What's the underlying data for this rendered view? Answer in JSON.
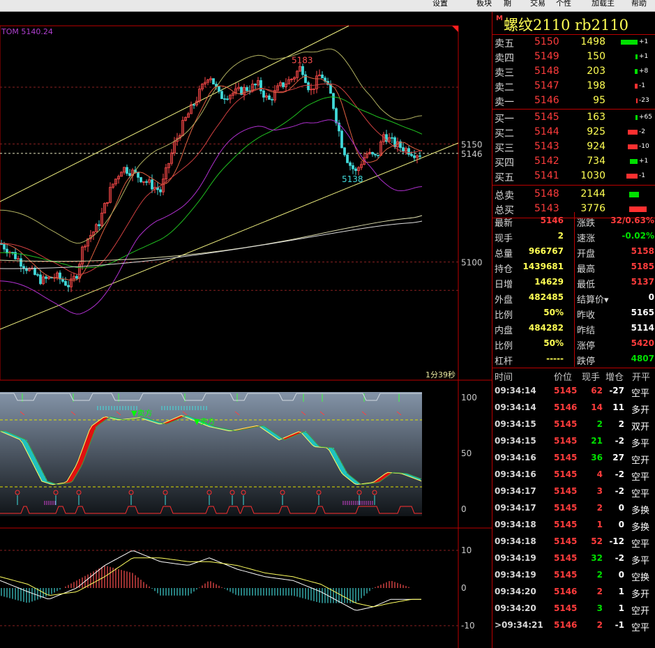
{
  "menu": [
    "设置",
    "板块",
    "期",
    "交易",
    "个性",
    "加载主",
    "帮助"
  ],
  "main_chart": {
    "indicator_label": "TOM 5140.24",
    "price_labels": [
      {
        "text": "5183",
        "price": 5183
      },
      {
        "text": "5138",
        "price": 5138
      }
    ],
    "axis_ticks": [
      {
        "text": "5150",
        "price": 5150
      },
      {
        "text": "5146",
        "price": 5146
      },
      {
        "text": "5100",
        "price": 5100
      }
    ],
    "dashed_levels": [
      5174,
      5150,
      5146,
      5100,
      5088
    ],
    "timer": "1分39秒",
    "price_min": 5050,
    "price_max": 5200
  },
  "kd_panel": {
    "ticks": [
      "100",
      "50",
      "0"
    ],
    "annotations": [
      {
        "text": "▼卖方",
        "color": "#00ff00"
      },
      {
        "text": "▼卖方",
        "color": "#00ff00"
      }
    ]
  },
  "macd_panel": {
    "ticks": [
      "10",
      "0",
      "-10"
    ]
  },
  "instrument": {
    "marker": "M",
    "name": "螺纹2110  rb2110"
  },
  "asks": [
    {
      "label": "卖五",
      "price": "5150",
      "volume": "1498",
      "change": "+1",
      "bar": 24
    },
    {
      "label": "卖四",
      "price": "5149",
      "volume": "150",
      "change": "+1",
      "bar": 3
    },
    {
      "label": "卖三",
      "price": "5148",
      "volume": "203",
      "change": "+8",
      "bar": 4
    },
    {
      "label": "卖二",
      "price": "5147",
      "volume": "198",
      "change": "-1",
      "bar": 4
    },
    {
      "label": "卖一",
      "price": "5146",
      "volume": "95",
      "change": "-23",
      "bar": 2
    }
  ],
  "bids": [
    {
      "label": "买一",
      "price": "5145",
      "volume": "163",
      "change": "+65",
      "bar": 3
    },
    {
      "label": "买二",
      "price": "5144",
      "volume": "925",
      "change": "-2",
      "bar": 14
    },
    {
      "label": "买三",
      "price": "5143",
      "volume": "924",
      "change": "-10",
      "bar": 14
    },
    {
      "label": "买四",
      "price": "5142",
      "volume": "734",
      "change": "+1",
      "bar": 11
    },
    {
      "label": "买五",
      "price": "5141",
      "volume": "1030",
      "change": "-1",
      "bar": 16
    }
  ],
  "totals": [
    {
      "label": "总卖",
      "price": "5148",
      "volume": "2144",
      "bar": 14,
      "bar_color": "#00e000"
    },
    {
      "label": "总买",
      "price": "5143",
      "volume": "3776",
      "bar": 25,
      "bar_color": "#ff3030"
    }
  ],
  "stats": [
    {
      "l1": "最新",
      "v1": "5146",
      "c1": "red",
      "l2": "涨跌",
      "v2": "32/0.63%",
      "c2": "red"
    },
    {
      "l1": "现手",
      "v1": "2",
      "c1": "yellow",
      "l2": "速涨",
      "v2": "-0.02%",
      "c2": "green"
    },
    {
      "l1": "总量",
      "v1": "966767",
      "c1": "yellow",
      "l2": "开盘",
      "v2": "5158",
      "c2": "red"
    },
    {
      "l1": "持仓",
      "v1": "1439681",
      "c1": "yellow",
      "l2": "最高",
      "v2": "5185",
      "c2": "red"
    },
    {
      "l1": "日增",
      "v1": "14629",
      "c1": "yellow",
      "l2": "最低",
      "v2": "5137",
      "c2": "red"
    },
    {
      "l1": "外盘",
      "v1": "482485",
      "c1": "yellow",
      "l2": "结算价▾",
      "v2": "0",
      "c2": "white"
    },
    {
      "l1": "比例",
      "v1": "50%",
      "c1": "yellow",
      "l2": "昨收",
      "v2": "5165",
      "c2": "white"
    },
    {
      "l1": "内盘",
      "v1": "484282",
      "c1": "yellow",
      "l2": "昨结",
      "v2": "5114",
      "c2": "white"
    },
    {
      "l1": "比例",
      "v1": "50%",
      "c1": "yellow",
      "l2": "涨停",
      "v2": "5420",
      "c2": "red"
    },
    {
      "l1": "杠杆",
      "v1": "-----",
      "c1": "yellow",
      "l2": "跌停",
      "v2": "4807",
      "c2": "green"
    }
  ],
  "ticks_header": [
    "时间",
    "价位",
    "现手",
    "增仓",
    "开平"
  ],
  "trades": [
    {
      "time": "09:34:14",
      "price": "5145",
      "vol": "62",
      "oi": "-27",
      "type": "空平",
      "pc": "red",
      "vc": "red",
      "oc": "white"
    },
    {
      "time": "09:34:14",
      "price": "5146",
      "vol": "14",
      "oi": "11",
      "type": "多开",
      "pc": "red",
      "vc": "red",
      "oc": "white"
    },
    {
      "time": "09:34:15",
      "price": "5145",
      "vol": "2",
      "oi": "2",
      "type": "双开",
      "pc": "red",
      "vc": "green",
      "oc": "white"
    },
    {
      "time": "09:34:15",
      "price": "5145",
      "vol": "21",
      "oi": "-2",
      "type": "多平",
      "pc": "red",
      "vc": "green",
      "oc": "white"
    },
    {
      "time": "09:34:16",
      "price": "5145",
      "vol": "36",
      "oi": "27",
      "type": "空开",
      "pc": "red",
      "vc": "green",
      "oc": "white"
    },
    {
      "time": "09:34:16",
      "price": "5145",
      "vol": "4",
      "oi": "-2",
      "type": "空平",
      "pc": "red",
      "vc": "red",
      "oc": "white"
    },
    {
      "time": "09:34:17",
      "price": "5145",
      "vol": "3",
      "oi": "-2",
      "type": "空平",
      "pc": "red",
      "vc": "red",
      "oc": "white"
    },
    {
      "time": "09:34:17",
      "price": "5145",
      "vol": "2",
      "oi": "0",
      "type": "多换",
      "pc": "red",
      "vc": "red",
      "oc": "white"
    },
    {
      "time": "09:34:18",
      "price": "5145",
      "vol": "1",
      "oi": "0",
      "type": "多换",
      "pc": "red",
      "vc": "red",
      "oc": "white"
    },
    {
      "time": "09:34:18",
      "price": "5145",
      "vol": "52",
      "oi": "-12",
      "type": "空平",
      "pc": "red",
      "vc": "red",
      "oc": "white"
    },
    {
      "time": "09:34:19",
      "price": "5145",
      "vol": "32",
      "oi": "-2",
      "type": "多平",
      "pc": "red",
      "vc": "green",
      "oc": "white"
    },
    {
      "time": "09:34:19",
      "price": "5145",
      "vol": "2",
      "oi": "0",
      "type": "空换",
      "pc": "red",
      "vc": "green",
      "oc": "white"
    },
    {
      "time": "09:34:20",
      "price": "5146",
      "vol": "2",
      "oi": "1",
      "type": "多开",
      "pc": "red",
      "vc": "red",
      "oc": "white"
    },
    {
      "time": "09:34:20",
      "price": "5145",
      "vol": "3",
      "oi": "1",
      "type": "空开",
      "pc": "red",
      "vc": "green",
      "oc": "white"
    },
    {
      "time": ">09:34:21",
      "price": "5146",
      "vol": "2",
      "oi": "-1",
      "type": "空平",
      "pc": "red",
      "vc": "red",
      "oc": "white"
    }
  ]
}
